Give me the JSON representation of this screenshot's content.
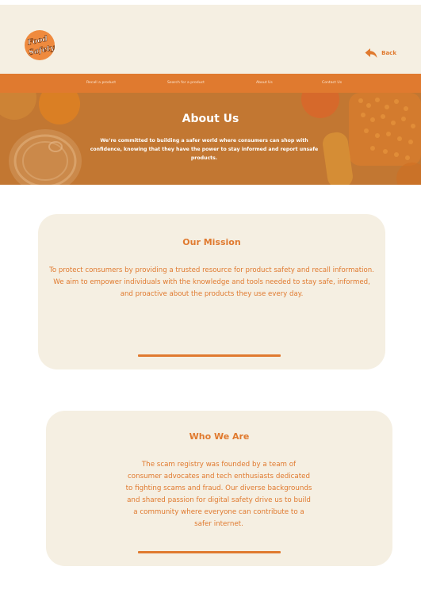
{
  "brand": {
    "logo_text": "Food Safety",
    "accent": "#e07a2f",
    "cream": "#f5efe2"
  },
  "header": {
    "back_label": "Back",
    "back_icon": "reply-arrow-icon"
  },
  "nav": [
    {
      "label": "Recall a product"
    },
    {
      "label": "Search for a product"
    },
    {
      "label": "About Us"
    },
    {
      "label": "Contact Us"
    }
  ],
  "hero": {
    "title": "About Us",
    "text": "We’re committed to building a safer world where consumers can shop with confidence, knowing that they have the power to stay informed and report unsafe products."
  },
  "mission": {
    "title": "Our Mission",
    "body": "To protect consumers by providing a trusted resource for product safety and recall information. We aim to empower individuals with the knowledge and tools needed to stay safe, informed, and proactive about the products they use every day."
  },
  "who": {
    "title": "Who We Are",
    "body": "The scam registry was founded by a team of consumer advocates and tech enthusiasts dedicated to fighting scams and fraud. Our diverse backgrounds and shared passion for digital safety drive us to build a community where everyone can contribute to a safer internet."
  }
}
